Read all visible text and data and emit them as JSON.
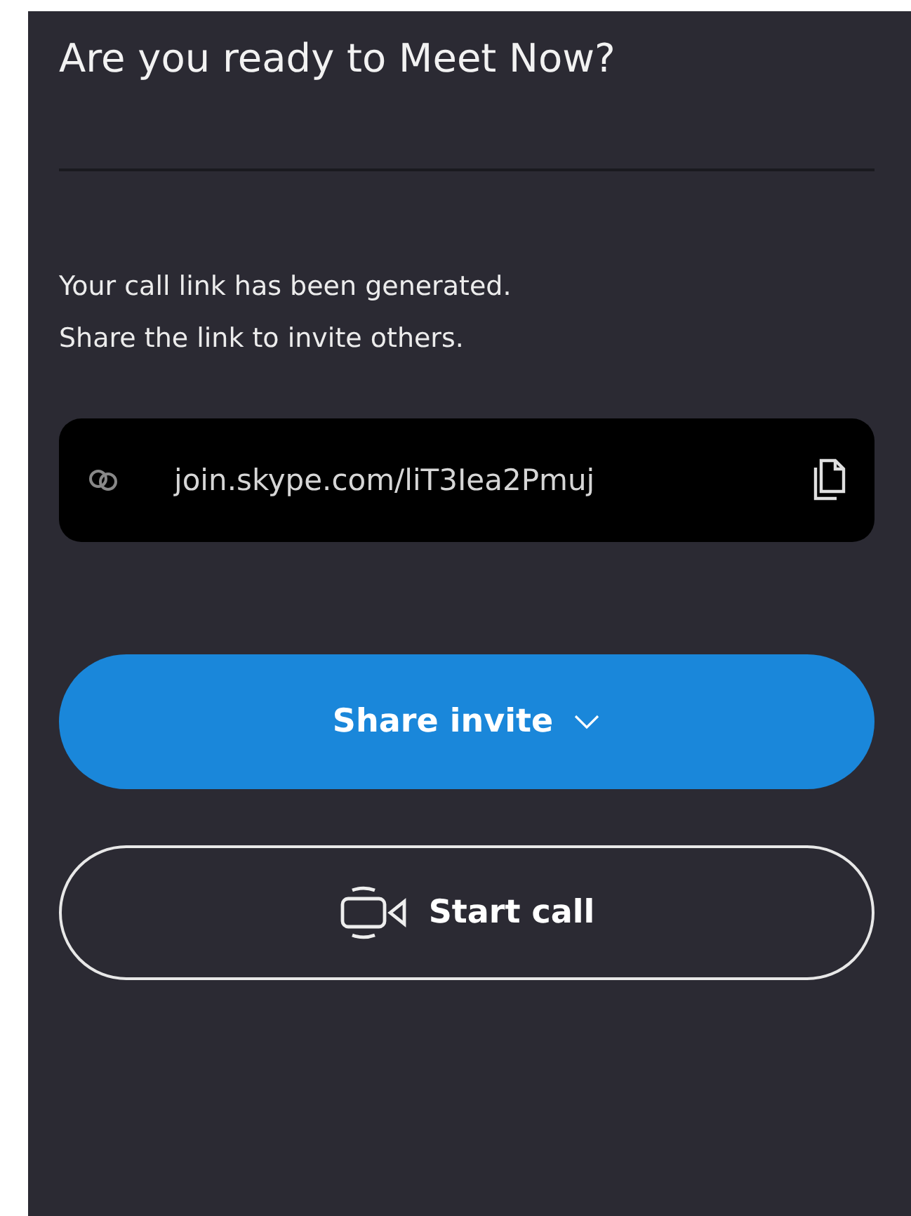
{
  "title": "Are you ready to Meet Now?",
  "message": [
    "Your call link has been generated.",
    "Share the link to invite others."
  ],
  "link": {
    "value": "join.skype.com/liT3Iea2Pmuj"
  },
  "buttons": [
    {
      "kind": "primary",
      "label": "Share invite"
    },
    {
      "kind": "outline",
      "label": "Start call"
    }
  ]
}
